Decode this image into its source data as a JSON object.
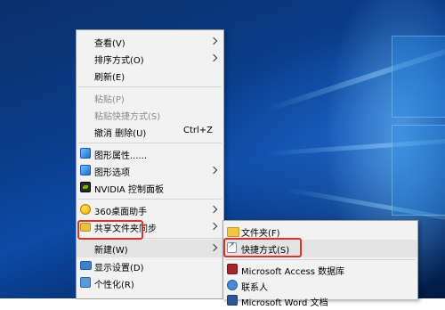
{
  "context_menu": {
    "items": [
      {
        "label": "查看(V)"
      },
      {
        "label": "排序方式(O)"
      },
      {
        "label": "刷新(E)"
      },
      {
        "label": "粘贴(P)"
      },
      {
        "label": "粘贴快捷方式(S)"
      },
      {
        "label": "撤消 删除(U)",
        "shortcut": "Ctrl+Z"
      },
      {
        "label": "图形属性......",
        "icon": "graphics-properties-icon"
      },
      {
        "label": "图形选项",
        "icon": "graphics-options-icon"
      },
      {
        "label": "NVIDIA 控制面板",
        "icon": "nvidia-icon"
      },
      {
        "label": "360桌面助手",
        "icon": "360-icon"
      },
      {
        "label": "共享文件夹同步",
        "icon": "share-folder-icon"
      },
      {
        "label": "新建(W)"
      },
      {
        "label": "显示设置(D)",
        "icon": "display-icon"
      },
      {
        "label": "个性化(R)",
        "icon": "personalize-icon"
      }
    ]
  },
  "submenu": {
    "items": [
      {
        "label": "文件夹(F)",
        "icon": "folder-icon"
      },
      {
        "label": "快捷方式(S)",
        "icon": "shortcut-icon"
      },
      {
        "label": "Microsoft Access 数据库",
        "icon": "access-icon"
      },
      {
        "label": "联系人",
        "icon": "contact-icon"
      },
      {
        "label": "Microsoft Word 文档",
        "icon": "word-icon"
      }
    ]
  },
  "colors": {
    "highlight_box": "#e0302a",
    "menu_background": "#f2f2f2",
    "desktop_blue": "#0b3d8a"
  }
}
